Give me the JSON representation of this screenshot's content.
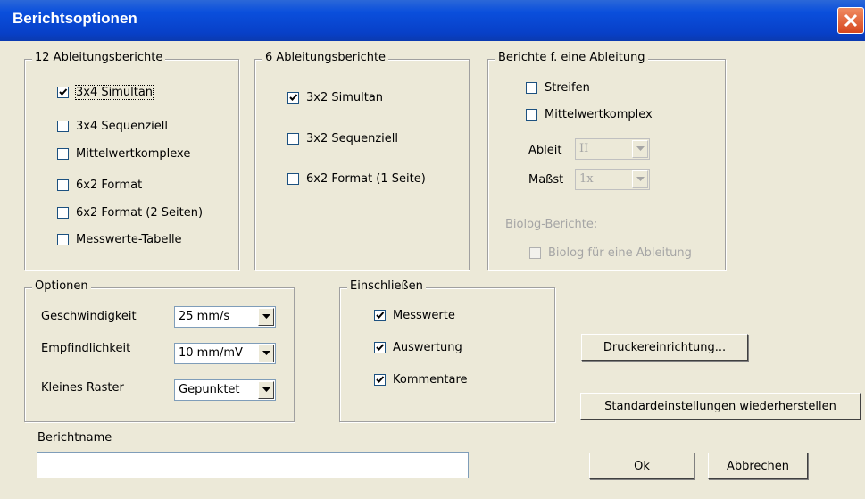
{
  "window": {
    "title": "Berichtsoptionen"
  },
  "group12": {
    "legend": "12 Ableitungsberichte",
    "items": [
      {
        "label": "3x4 Simultan",
        "checked": true
      },
      {
        "label": "3x4 Sequenziell",
        "checked": false
      },
      {
        "label": "Mittelwertkomplexe",
        "checked": false
      },
      {
        "label": "6x2 Format",
        "checked": false
      },
      {
        "label": "6x2 Format (2 Seiten)",
        "checked": false
      },
      {
        "label": "Messwerte-Tabelle",
        "checked": false
      }
    ]
  },
  "group6": {
    "legend": "6 Ableitungsberichte",
    "items": [
      {
        "label": "3x2 Simultan",
        "checked": true
      },
      {
        "label": "3x2 Sequenziell",
        "checked": false
      },
      {
        "label": "6x2 Format (1 Seite)",
        "checked": false
      }
    ]
  },
  "groupSingle": {
    "legend": "Berichte f. eine Ableitung",
    "items": [
      {
        "label": "Streifen",
        "checked": false
      },
      {
        "label": "Mittelwertkomplex",
        "checked": false
      }
    ],
    "ableit_label": "Ableit",
    "ableit_value": "II",
    "masst_label": "Maßst",
    "masst_value": "1x",
    "biolog_heading": "Biolog-Berichte:",
    "biolog_label": "Biolog für eine Ableitung"
  },
  "options": {
    "legend": "Optionen",
    "geschwindigkeit_label": "Geschwindigkeit",
    "geschwindigkeit_value": "25 mm/s",
    "empfindlichkeit_label": "Empfindlichkeit",
    "empfindlichkeit_value": "10 mm/mV",
    "raster_label": "Kleines Raster",
    "raster_value": "Gepunktet"
  },
  "include": {
    "legend": "Einschließen",
    "items": [
      {
        "label": "Messwerte",
        "checked": true
      },
      {
        "label": "Auswertung",
        "checked": true
      },
      {
        "label": "Kommentare",
        "checked": true
      }
    ]
  },
  "buttons": {
    "printer_setup": "Druckereinrichtung...",
    "restore_defaults": "Standardeinstellungen wiederherstellen",
    "ok": "Ok",
    "cancel": "Abbrechen"
  },
  "report_name": {
    "label": "Berichtname",
    "value": ""
  },
  "icons": {
    "close": "close-icon",
    "check": "checkmark-icon",
    "dropdown": "chevron-down-icon"
  }
}
